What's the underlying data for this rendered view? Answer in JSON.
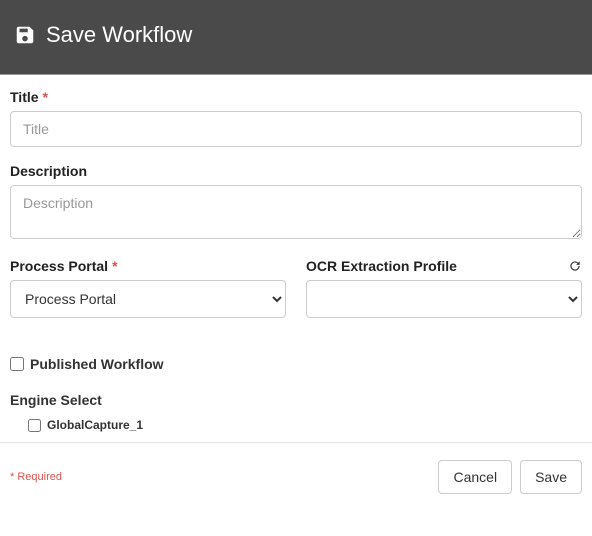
{
  "header": {
    "title": "Save Workflow"
  },
  "fields": {
    "title": {
      "label": "Title",
      "required": true,
      "placeholder": "Title",
      "value": ""
    },
    "description": {
      "label": "Description",
      "placeholder": "Description",
      "value": ""
    },
    "processPortal": {
      "label": "Process Portal",
      "required": true,
      "selected": "Process Portal",
      "options": [
        "Process Portal"
      ]
    },
    "ocrProfile": {
      "label": "OCR Extraction Profile",
      "selected": "",
      "options": [
        ""
      ]
    },
    "publishedWorkflow": {
      "label": "Published Workflow",
      "checked": false
    },
    "engineSelect": {
      "label": "Engine Select",
      "items": [
        {
          "label": "GlobalCapture_1",
          "checked": false
        }
      ]
    }
  },
  "footer": {
    "requiredNote": "* Required",
    "cancel": "Cancel",
    "save": "Save"
  },
  "requiredMark": "*"
}
